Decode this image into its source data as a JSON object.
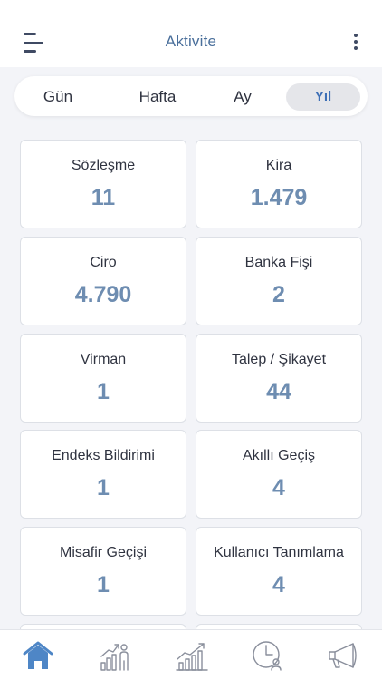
{
  "header": {
    "title": "Aktivite"
  },
  "tabs": [
    {
      "label": "Gün"
    },
    {
      "label": "Hafta"
    },
    {
      "label": "Ay"
    },
    {
      "label": "Yıl",
      "selected": true
    }
  ],
  "cards": [
    {
      "label": "Sözleşme",
      "value": "11"
    },
    {
      "label": "Kira",
      "value": "1.479"
    },
    {
      "label": "Ciro",
      "value": "4.790"
    },
    {
      "label": "Banka Fişi",
      "value": "2"
    },
    {
      "label": "Virman",
      "value": "1"
    },
    {
      "label": "Talep / Şikayet",
      "value": "44"
    },
    {
      "label": "Endeks Bildirimi",
      "value": "1"
    },
    {
      "label": "Akıllı Geçiş",
      "value": "4"
    },
    {
      "label": "Misafir Geçişi",
      "value": "1"
    },
    {
      "label": "Kullanıcı Tanımlama",
      "value": "4"
    }
  ],
  "bottom_nav": [
    {
      "icon": "home-icon",
      "active": true
    },
    {
      "icon": "people-chart-icon"
    },
    {
      "icon": "growth-chart-icon"
    },
    {
      "icon": "clock-person-icon"
    },
    {
      "icon": "megaphone-icon"
    }
  ],
  "colors": {
    "accent": "#4a6f9b",
    "value": "#6e8db1",
    "selected_tab_text": "#3d6fb6",
    "home_active": "#4e86c6"
  }
}
